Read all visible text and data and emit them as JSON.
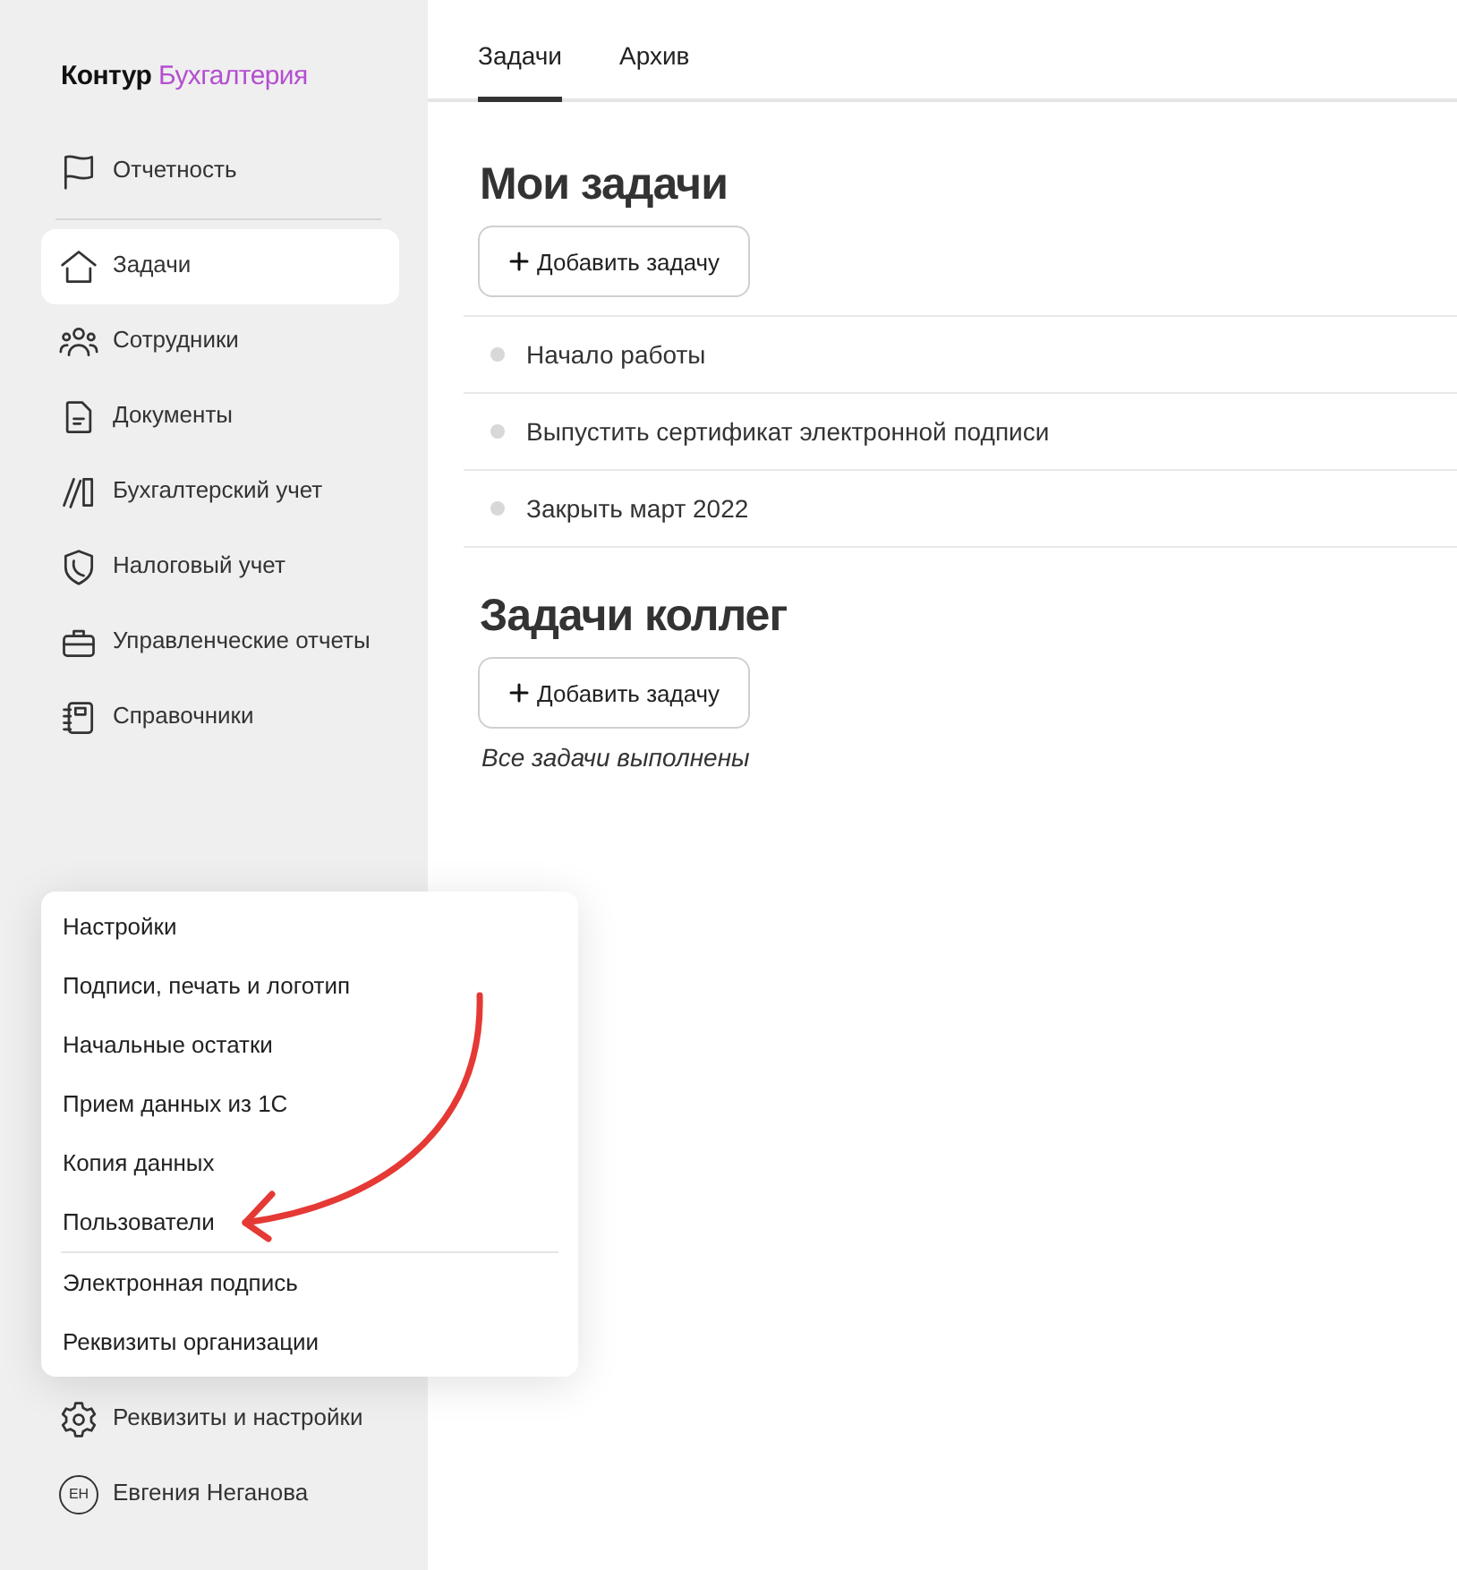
{
  "logo": {
    "brand": "Контур",
    "product": "Бухгалтерия"
  },
  "sidebar": {
    "items": [
      {
        "label": "Отчетность",
        "selected": false
      },
      {
        "label": "Задачи",
        "selected": true
      },
      {
        "label": "Сотрудники",
        "selected": false
      },
      {
        "label": "Документы",
        "selected": false
      },
      {
        "label": "Бухгалтерский учет",
        "selected": false
      },
      {
        "label": "Налоговый учет",
        "selected": false
      },
      {
        "label": "Управленческие отчеты",
        "selected": false
      },
      {
        "label": "Справочники",
        "selected": false
      }
    ],
    "settings": {
      "label": "Реквизиты и настройки"
    },
    "user": {
      "initials": "ЕН",
      "name": "Евгения Неганова"
    }
  },
  "tabs": [
    {
      "label": "Задачи",
      "selected": true
    },
    {
      "label": "Архив",
      "selected": false
    }
  ],
  "sections": [
    {
      "title": "Мои задачи",
      "add_button": "Добавить задачу",
      "tasks": [
        "Начало работы",
        "Выпустить сертификат электронной подписи",
        "Закрыть март 2022"
      ]
    },
    {
      "title": "Задачи коллег",
      "add_button": "Добавить задачу",
      "empty_note": "Все задачи выполнены"
    }
  ],
  "popup_menu": {
    "groups": [
      [
        "Настройки",
        "Подписи, печать и логотип",
        "Начальные остатки",
        "Прием данных из 1С",
        "Копия данных",
        "Пользователи"
      ],
      [
        "Электронная подпись",
        "Реквизиты организации"
      ]
    ]
  }
}
